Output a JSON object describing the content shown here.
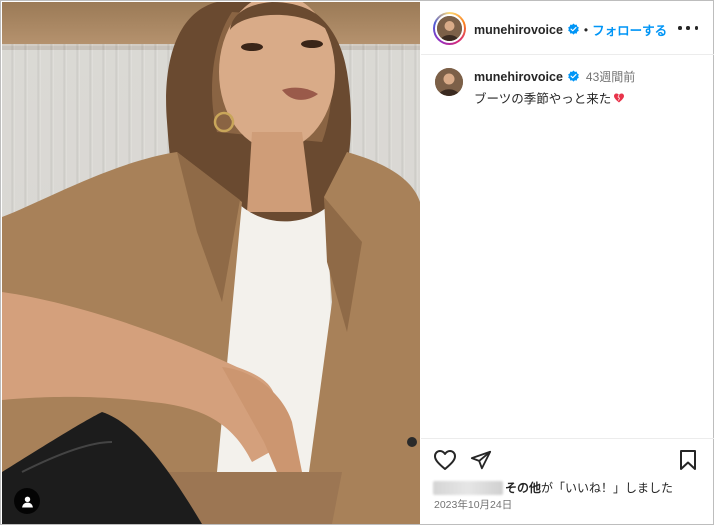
{
  "post": {
    "username": "munehirovoice",
    "follow_label": "フォローする",
    "separator": "•",
    "caption_time": "43週間前",
    "caption_text": "ブーツの季節やっと来た",
    "likes_bold": "その他",
    "likes_text": "が「いいね！」しました",
    "date": "2023年10月24日"
  },
  "icons": {
    "verified": "verified-badge-icon",
    "more": "more-options-icon",
    "like": "heart-outline-icon",
    "share": "paper-plane-icon",
    "save": "bookmark-icon",
    "user": "user-tag-icon",
    "emoji": "heart-emoji-icon"
  },
  "colors": {
    "accent": "#0095f6",
    "text": "#262626",
    "muted": "#737373"
  }
}
